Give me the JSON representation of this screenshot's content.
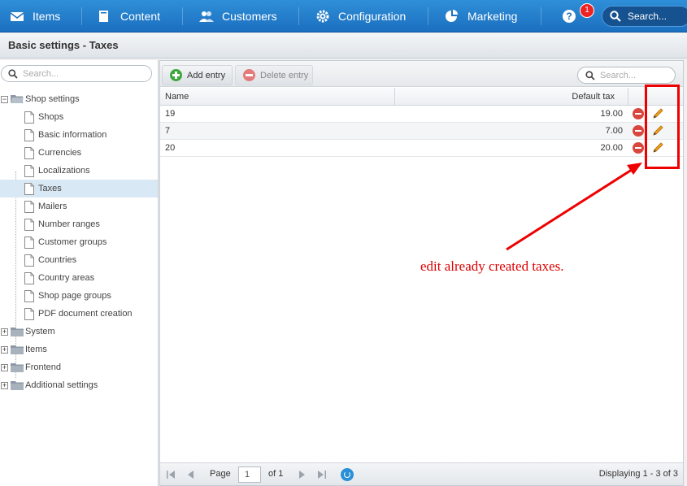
{
  "nav": {
    "items": [
      {
        "label": "Items",
        "icon": "items-icon"
      },
      {
        "label": "Content",
        "icon": "content-icon"
      },
      {
        "label": "Customers",
        "icon": "customers-icon"
      },
      {
        "label": "Configuration",
        "icon": "gear-icon"
      },
      {
        "label": "Marketing",
        "icon": "pie-chart-icon"
      }
    ],
    "help_label": "?",
    "notification_count": "1",
    "search_label": "Search..."
  },
  "page_title": "Basic settings - Taxes",
  "tree": {
    "search_placeholder": "Search...",
    "root": "Shop settings",
    "children": [
      "Shops",
      "Basic information",
      "Currencies",
      "Localizations",
      "Taxes",
      "Mailers",
      "Number ranges",
      "Customer groups",
      "Countries",
      "Country areas",
      "Shop page groups",
      "PDF document creation"
    ],
    "selected": "Taxes",
    "other_roots": [
      "System",
      "Items",
      "Frontend",
      "Additional settings"
    ]
  },
  "toolbar": {
    "add_label": "Add entry",
    "delete_label": "Delete entry",
    "search_placeholder": "Search..."
  },
  "grid": {
    "columns": [
      "Name",
      "Default tax"
    ],
    "rows": [
      {
        "name": "19",
        "tax": "19.00"
      },
      {
        "name": "7",
        "tax": "7.00"
      },
      {
        "name": "20",
        "tax": "20.00"
      }
    ]
  },
  "pager": {
    "page_label": "Page",
    "page_value": "1",
    "of_label": "of 1",
    "display_text": "Displaying 1 - 3 of 3"
  },
  "annotation": {
    "text": "edit already created taxes.",
    "color": "#dd0000"
  }
}
